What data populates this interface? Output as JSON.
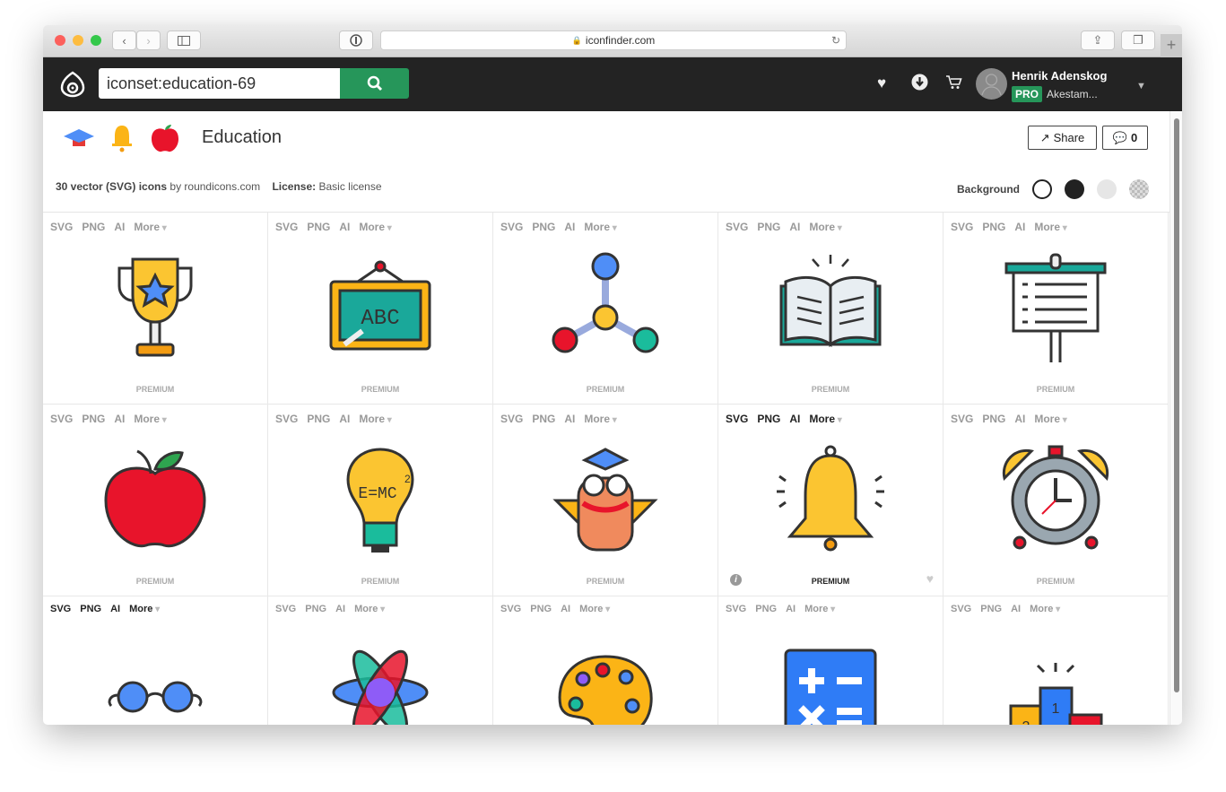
{
  "browser": {
    "url": "iconfinder.com",
    "colors": {
      "close": "#fc605c",
      "min": "#fdbc40",
      "max": "#34c84a"
    }
  },
  "nav": {
    "search_value": "iconset:education-69",
    "user_name": "Henrik Adenskog",
    "badge": "PRO",
    "org": "Akestam...",
    "accent": "#26965a"
  },
  "iconset": {
    "title": "Education",
    "share_label": "Share",
    "comment_count": "0",
    "count_text": "30 vector (SVG) icons",
    "by_text": "by roundicons.com",
    "license_label": "License:",
    "license_value": "Basic license",
    "background_label": "Background"
  },
  "formats": [
    "SVG",
    "PNG",
    "AI",
    "More"
  ],
  "icons": [
    {
      "name": "trophy",
      "label": "PREMIUM"
    },
    {
      "name": "chalkboard-abc",
      "label": "PREMIUM"
    },
    {
      "name": "molecule",
      "label": "PREMIUM"
    },
    {
      "name": "open-book",
      "label": "PREMIUM"
    },
    {
      "name": "presentation-board",
      "label": "PREMIUM"
    },
    {
      "name": "apple",
      "label": "PREMIUM"
    },
    {
      "name": "lightbulb-emc2",
      "label": "PREMIUM"
    },
    {
      "name": "owl-graduate",
      "label": "PREMIUM"
    },
    {
      "name": "bell",
      "label": "PREMIUM"
    },
    {
      "name": "alarm-clock",
      "label": "PREMIUM"
    },
    {
      "name": "glasses"
    },
    {
      "name": "atom"
    },
    {
      "name": "paint-palette"
    },
    {
      "name": "calculator"
    },
    {
      "name": "podium"
    }
  ]
}
